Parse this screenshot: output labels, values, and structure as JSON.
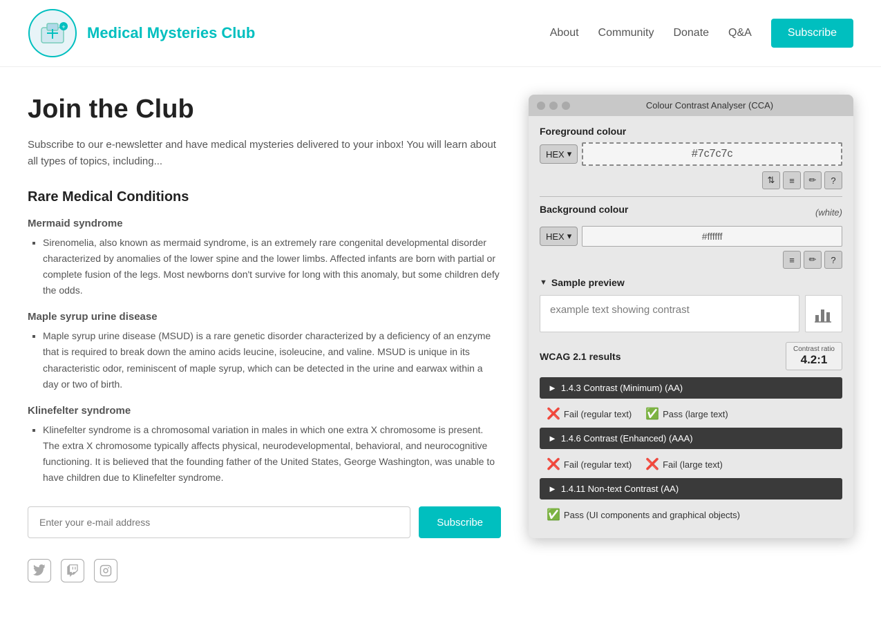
{
  "header": {
    "site_title": "Medical Mysteries Club",
    "nav_items": [
      {
        "label": "About"
      },
      {
        "label": "Community"
      },
      {
        "label": "Donate"
      },
      {
        "label": "Q&A"
      }
    ],
    "subscribe_label": "Subscribe"
  },
  "main": {
    "page_title": "Join the Club",
    "intro": "Subscribe to our e-newsletter and have medical mysteries delivered to your inbox! You will learn about all types of topics, including...",
    "section_title": "Rare Medical Conditions",
    "conditions": [
      {
        "title": "Mermaid syndrome",
        "description": "Sirenomelia, also known as mermaid syndrome, is an extremely rare congenital developmental disorder characterized by anomalies of the lower spine and the lower limbs. Affected infants are born with partial or complete fusion of the legs. Most newborns don't survive for long with this anomaly, but some children defy the odds."
      },
      {
        "title": "Maple syrup urine disease",
        "description": "Maple syrup urine disease (MSUD) is a rare genetic disorder characterized by a deficiency of an enzyme that is required to break down the amino acids leucine, isoleucine, and valine. MSUD is unique in its characteristic odor, reminiscent of maple syrup, which can be detected in the urine and earwax within a day or two of birth."
      },
      {
        "title": "Klinefelter syndrome",
        "description": "Klinefelter syndrome is a chromosomal variation in males in which one extra X chromosome is present. The extra X chromosome typically affects physical, neurodevelopmental, behavioral, and neurocognitive functioning. It is believed that the founding father of the United States, George Washington, was unable to have children due to Klinefelter syndrome."
      }
    ],
    "email_placeholder": "Enter your e-mail address",
    "subscribe_btn_label": "Subscribe"
  },
  "cca_panel": {
    "title": "Colour Contrast Analyser (CCA)",
    "fg_label": "Foreground colour",
    "fg_format": "HEX",
    "fg_value": "#7c7c7c",
    "bg_label": "Background colour",
    "bg_white_label": "(white)",
    "bg_format": "HEX",
    "bg_value": "#ffffff",
    "sample_label": "Sample preview",
    "sample_text": "example text showing contrast",
    "wcag_label": "WCAG 2.1 results",
    "contrast_ratio_label": "Contrast ratio",
    "contrast_ratio_value": "4.2:1",
    "results": [
      {
        "id": "1.4.3",
        "label": "1.4.3 Contrast (Minimum) (AA)",
        "items": [
          {
            "icon": "fail",
            "text": "Fail (regular text)"
          },
          {
            "icon": "pass",
            "text": "Pass (large text)"
          }
        ]
      },
      {
        "id": "1.4.6",
        "label": "1.4.6 Contrast (Enhanced) (AAA)",
        "items": [
          {
            "icon": "fail",
            "text": "Fail (regular text)"
          },
          {
            "icon": "fail",
            "text": "Fail (large text)"
          }
        ]
      },
      {
        "id": "1.4.11",
        "label": "1.4.11 Non-text Contrast (AA)",
        "items": [
          {
            "icon": "pass",
            "text": "Pass (UI components and graphical objects)"
          }
        ]
      }
    ]
  }
}
